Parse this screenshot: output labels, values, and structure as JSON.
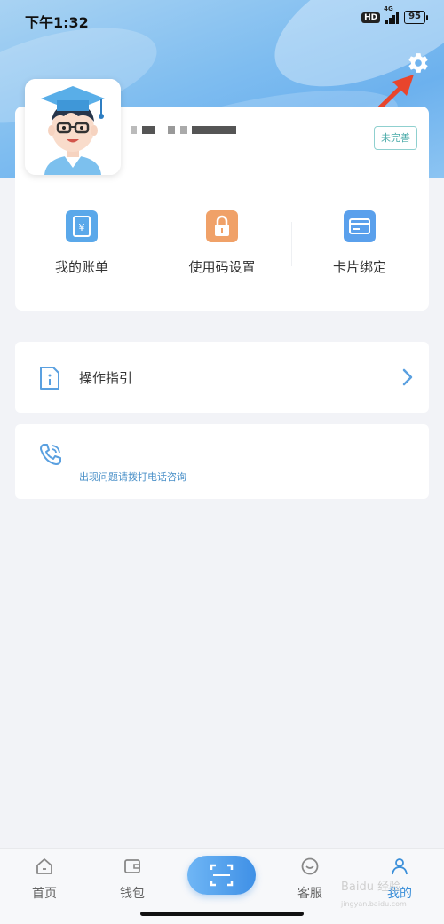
{
  "status_bar": {
    "time": "下午1:32",
    "hd": "HD",
    "network": "4G",
    "battery": "95"
  },
  "profile": {
    "incomplete_label": "未完善"
  },
  "functions": [
    {
      "label": "我的账单",
      "icon": "bill-icon",
      "color": "#5aa8ea"
    },
    {
      "label": "使用码设置",
      "icon": "lock-icon",
      "color": "#f0a168"
    },
    {
      "label": "卡片绑定",
      "icon": "card-icon",
      "color": "#5aa0ec"
    }
  ],
  "guide": {
    "label": "操作指引",
    "icon": "info-document-icon"
  },
  "contact": {
    "text": "出现问题请拨打电话咨询",
    "icon": "phone-icon"
  },
  "tab_bar": {
    "items": [
      {
        "label": "首页",
        "icon": "home-icon"
      },
      {
        "label": "钱包",
        "icon": "wallet-icon"
      },
      {
        "label": "客服",
        "icon": "chat-icon"
      },
      {
        "label": "我的",
        "icon": "person-icon",
        "active": true
      }
    ],
    "scan_icon": "scan-icon"
  },
  "watermark": {
    "brand": "Baidu 经验",
    "url": "jingyan.baidu.com"
  },
  "colors": {
    "accent": "#3b8fd9",
    "arrow": "#e8452c",
    "header_gradient": "#7fbdf0"
  }
}
